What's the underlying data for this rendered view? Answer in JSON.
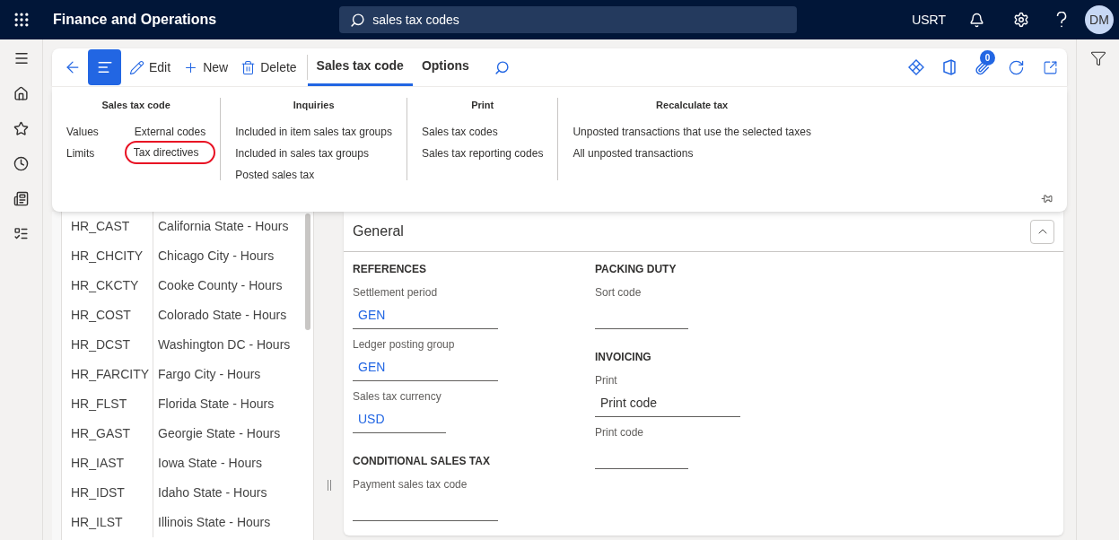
{
  "app": {
    "title": "Finance and Operations",
    "search": "sales tax codes",
    "company": "USRT",
    "avatar": "DM"
  },
  "toolbar": {
    "buttons": [
      {
        "label": "Edit",
        "kind": "edit"
      },
      {
        "label": "New",
        "kind": "new"
      },
      {
        "label": "Delete",
        "kind": "delete"
      }
    ],
    "tabs": [
      {
        "label": "Sales tax code",
        "selected": true
      },
      {
        "label": "Options",
        "selected": false
      }
    ],
    "attachments_badge": "0"
  },
  "flyout": {
    "groups": [
      {
        "title": "Sales tax code",
        "columns": [
          [
            {
              "label": "Values",
              "highlighted": false
            },
            {
              "label": "Limits",
              "highlighted": false
            }
          ],
          [
            {
              "label": "External codes",
              "highlighted": false
            },
            {
              "label": "Tax directives",
              "highlighted": true
            }
          ]
        ]
      },
      {
        "title": "Inquiries",
        "columns": [
          [
            {
              "label": "Included in item sales tax groups",
              "highlighted": false
            },
            {
              "label": "Included in sales tax groups",
              "highlighted": false
            },
            {
              "label": "Posted sales tax",
              "highlighted": false
            }
          ]
        ]
      },
      {
        "title": "Print",
        "columns": [
          [
            {
              "label": "Sales tax codes",
              "highlighted": false
            },
            {
              "label": "Sales tax reporting codes",
              "highlighted": false
            }
          ]
        ]
      },
      {
        "title": "Recalculate tax",
        "columns": [
          [
            {
              "label": "Unposted transactions that use the selected taxes",
              "highlighted": false
            },
            {
              "label": "All unposted transactions",
              "highlighted": false
            }
          ]
        ]
      }
    ]
  },
  "list": {
    "rows": [
      {
        "code": "HR_CAST",
        "description": "California State - Hours"
      },
      {
        "code": "HR_CHCITY",
        "description": "Chicago City - Hours"
      },
      {
        "code": "HR_CKCTY",
        "description": "Cooke County - Hours"
      },
      {
        "code": "HR_COST",
        "description": "Colorado State - Hours"
      },
      {
        "code": "HR_DCST",
        "description": "Washington DC - Hours"
      },
      {
        "code": "HR_FARCITY",
        "description": "Fargo City - Hours"
      },
      {
        "code": "HR_FLST",
        "description": "Florida State - Hours"
      },
      {
        "code": "HR_GAST",
        "description": "Georgie State - Hours"
      },
      {
        "code": "HR_IAST",
        "description": "Iowa State - Hours"
      },
      {
        "code": "HR_IDST",
        "description": "Idaho State - Hours"
      },
      {
        "code": "HR_ILST",
        "description": "Illinois State - Hours"
      }
    ]
  },
  "details": {
    "title": "General",
    "expanded": true,
    "columns": [
      [
        {
          "heading": "REFERENCES",
          "fields": [
            {
              "label": "Settlement period",
              "value": "GEN",
              "link": true,
              "kind": "long"
            },
            {
              "label": "Ledger posting group",
              "value": "GEN",
              "link": true,
              "kind": "long"
            },
            {
              "label": "Sales tax currency",
              "value": "USD",
              "link": true,
              "kind": "short"
            }
          ]
        },
        {
          "heading": "CONDITIONAL SALES TAX",
          "fields": [
            {
              "label": "Payment sales tax code",
              "link": false,
              "kind": "long"
            }
          ]
        }
      ],
      [
        {
          "heading": "PACKING DUTY",
          "fields": [
            {
              "label": "Sort code",
              "link": false,
              "kind": "short"
            }
          ]
        },
        {
          "heading": "INVOICING",
          "fields": [
            {
              "label": "Print",
              "value": "Print code",
              "link": false,
              "kind": "long"
            },
            {
              "label": "Print code",
              "link": false,
              "kind": "short"
            }
          ]
        }
      ]
    ]
  }
}
